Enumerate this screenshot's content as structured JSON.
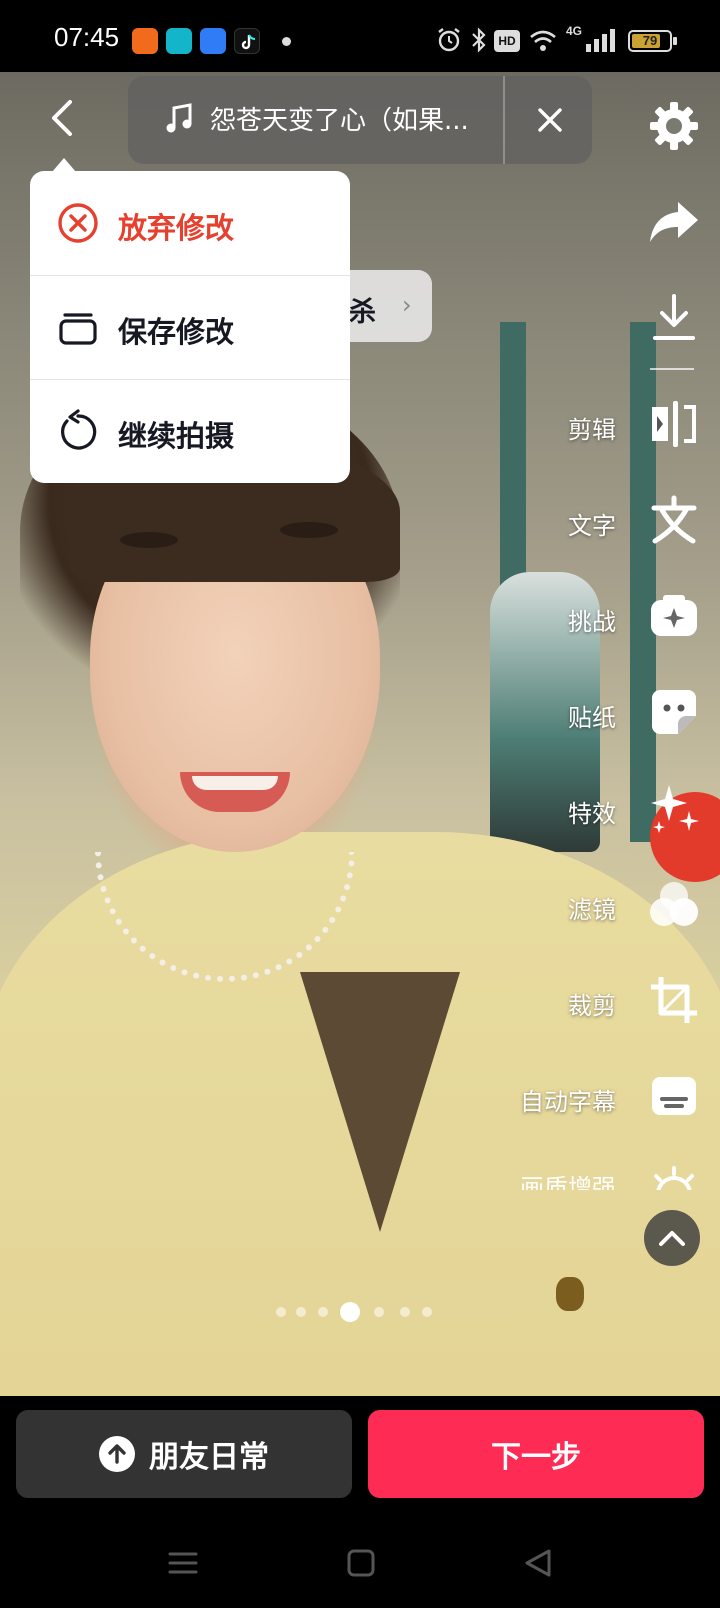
{
  "status_bar": {
    "time": "07:45",
    "battery": "79",
    "battery_percent": 79,
    "network": "4G",
    "hd_badge": "HD",
    "app_icons": [
      "xiaohongshu-icon",
      "home-app-icon",
      "browser-app-icon",
      "douyin-icon"
    ]
  },
  "music": {
    "title": "怨苍天变了心（如果..."
  },
  "menu": {
    "items": [
      {
        "label": "放弃修改",
        "icon": "close-circle-icon",
        "color": "#e6402e"
      },
      {
        "label": "保存修改",
        "icon": "drafts-box-icon"
      },
      {
        "label": "继续拍摄",
        "icon": "reshoot-icon"
      }
    ]
  },
  "chip": {
    "text": "反杀",
    "chevron": "›"
  },
  "toolbar": {
    "items": [
      {
        "label": "",
        "icon": "settings-icon"
      },
      {
        "label": "",
        "icon": "share-icon"
      },
      {
        "label": "",
        "icon": "download-icon"
      },
      {
        "label": "剪辑",
        "icon": "edit-clip-icon"
      },
      {
        "label": "文字",
        "icon": "text-icon"
      },
      {
        "label": "挑战",
        "icon": "challenge-icon"
      },
      {
        "label": "贴纸",
        "icon": "sticker-icon"
      },
      {
        "label": "特效",
        "icon": "effects-icon"
      },
      {
        "label": "滤镜",
        "icon": "filter-icon"
      },
      {
        "label": "裁剪",
        "icon": "crop-icon"
      },
      {
        "label": "自动字幕",
        "icon": "auto-captions-icon"
      },
      {
        "label": "画质增强",
        "icon": "enhance-icon"
      }
    ]
  },
  "pager": {
    "count": 7,
    "active_index": 3
  },
  "actions": {
    "daily_label": "朋友日常",
    "next_label": "下一步"
  },
  "colors": {
    "accent": "#fe2c55",
    "danger": "#e6402e",
    "dark_button": "#333333"
  },
  "navbar": {
    "icons": [
      "menu-nav-icon",
      "home-nav-icon",
      "back-nav-icon"
    ]
  }
}
